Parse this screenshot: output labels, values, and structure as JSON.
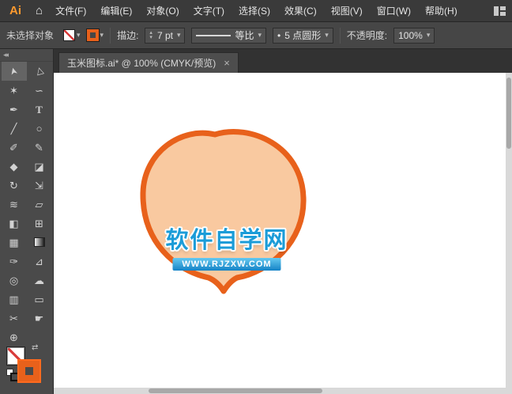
{
  "app": {
    "logo_text": "Ai",
    "home_glyph": "⌂"
  },
  "menu_bar": {
    "items": [
      "文件(F)",
      "编辑(E)",
      "对象(O)",
      "文字(T)",
      "选择(S)",
      "效果(C)",
      "视图(V)",
      "窗口(W)",
      "帮助(H)"
    ]
  },
  "control_bar": {
    "selection_status": "未选择对象",
    "stroke_label": "描边:",
    "stroke_weight_value": "7 pt",
    "profile_value": "等比",
    "brush_dot": "•",
    "brush_value": "5 点圆形",
    "opacity_label": "不透明度:",
    "opacity_value": "100%"
  },
  "document_tab": {
    "title": "玉米图标.ai* @ 100% (CMYK/预览)",
    "close_glyph": "×"
  },
  "toolbar": {
    "collapse_glyph": "◂◂",
    "tools": [
      {
        "name": "selection-tool",
        "glyph": "➤",
        "active": true
      },
      {
        "name": "direct-selection-tool",
        "glyph": "▷"
      },
      {
        "name": "magic-wand-tool",
        "glyph": "✶"
      },
      {
        "name": "lasso-tool",
        "glyph": "∽"
      },
      {
        "name": "pen-tool",
        "glyph": "✒"
      },
      {
        "name": "type-tool",
        "glyph": "T"
      },
      {
        "name": "line-segment-tool",
        "glyph": "╱"
      },
      {
        "name": "ellipse-tool",
        "glyph": "○"
      },
      {
        "name": "paintbrush-tool",
        "glyph": "✐"
      },
      {
        "name": "pencil-tool",
        "glyph": "✎"
      },
      {
        "name": "shaper-tool",
        "glyph": "◆"
      },
      {
        "name": "eraser-tool",
        "glyph": "◪"
      },
      {
        "name": "rotate-tool",
        "glyph": "↻"
      },
      {
        "name": "scale-tool",
        "glyph": "⇲"
      },
      {
        "name": "width-tool",
        "glyph": "≋"
      },
      {
        "name": "free-transform-tool",
        "glyph": "▱"
      },
      {
        "name": "shape-builder-tool",
        "glyph": "◧"
      },
      {
        "name": "perspective-grid-tool",
        "glyph": "⊞"
      },
      {
        "name": "mesh-tool",
        "glyph": "▦"
      },
      {
        "name": "gradient-tool",
        "glyph": "",
        "gradient": true
      },
      {
        "name": "eyedropper-tool",
        "glyph": "✑"
      },
      {
        "name": "measure-tool",
        "glyph": "⊿"
      },
      {
        "name": "blend-tool",
        "glyph": "◎"
      },
      {
        "name": "symbol-sprayer-tool",
        "glyph": "☁"
      },
      {
        "name": "column-graph-tool",
        "glyph": "▥"
      },
      {
        "name": "artboard-tool",
        "glyph": "▭"
      },
      {
        "name": "slice-tool",
        "glyph": "✂"
      },
      {
        "name": "hand-tool",
        "glyph": "☛"
      },
      {
        "name": "zoom-tool",
        "glyph": "⊕"
      }
    ]
  },
  "canvas": {
    "watermark_title": "软件自学网",
    "watermark_url": "WWW.RJZXW.COM"
  },
  "ui": {
    "chevron_down": "▾",
    "stepper_up": "▴",
    "stepper_down": "▾",
    "swap_glyph": "⇄"
  },
  "colors": {
    "shape_fill": "#F9C9A0",
    "shape_stroke": "#E8611B",
    "watermark_blue": "#1B9CD8",
    "ui_accent_orange": "#E8611B"
  }
}
